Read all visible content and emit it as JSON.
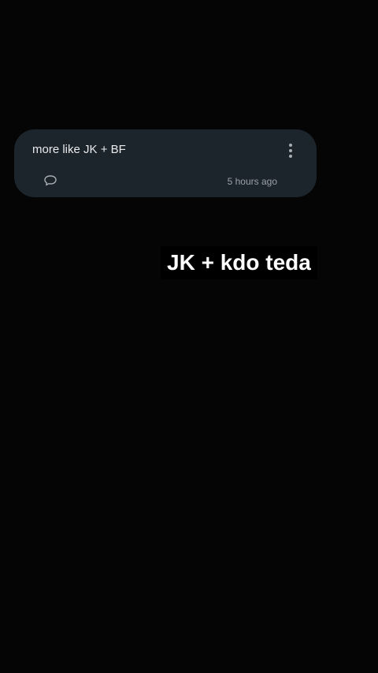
{
  "comment": {
    "text": "more like JK + BF",
    "timestamp": "5 hours ago",
    "reply_icon": "speech-bubble-icon",
    "more_icon": "vertical-dots-icon"
  },
  "caption": {
    "text": "JK + kdo teda"
  },
  "colors": {
    "background": "#050505",
    "card": "#1d252c",
    "caption_bg": "#000000",
    "caption_text": "#ffffff"
  }
}
